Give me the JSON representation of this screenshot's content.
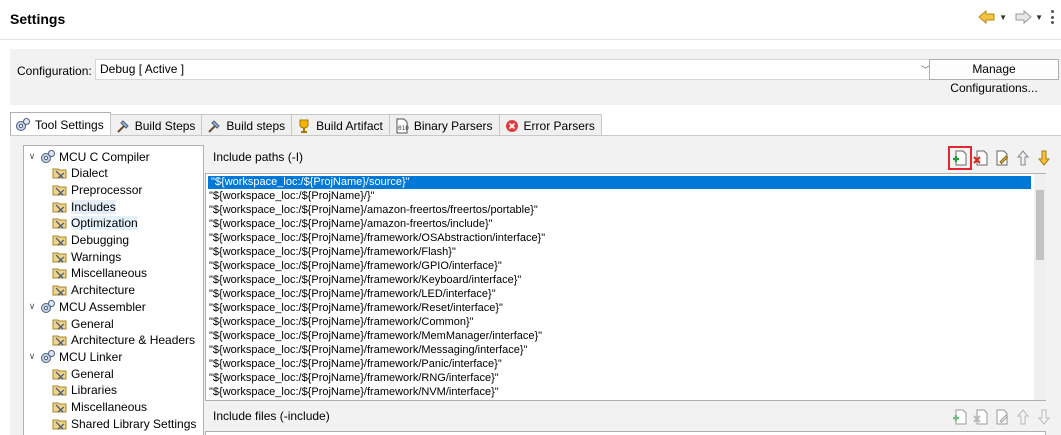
{
  "window": {
    "title": "Settings"
  },
  "configuration": {
    "label": "Configuration:",
    "value": "Debug  [ Active ]",
    "manage_label": "Manage Configurations..."
  },
  "tabs": [
    {
      "label": "Tool Settings",
      "icon": "gears-icon",
      "active": true
    },
    {
      "label": "Build Steps",
      "icon": "hammer-icon",
      "active": false
    },
    {
      "label": "Build steps",
      "icon": "hammer-icon",
      "active": false
    },
    {
      "label": "Build Artifact",
      "icon": "trophy-icon",
      "active": false
    },
    {
      "label": "Binary Parsers",
      "icon": "binary-icon",
      "active": false
    },
    {
      "label": "Error Parsers",
      "icon": "error-icon",
      "active": false
    }
  ],
  "tree": [
    {
      "label": "MCU C Compiler",
      "level": 0,
      "expanded": true
    },
    {
      "label": "Dialect",
      "level": 1
    },
    {
      "label": "Preprocessor",
      "level": 1
    },
    {
      "label": "Includes",
      "level": 1,
      "selected": true
    },
    {
      "label": "Optimization",
      "level": 1,
      "hovered": true
    },
    {
      "label": "Debugging",
      "level": 1
    },
    {
      "label": "Warnings",
      "level": 1
    },
    {
      "label": "Miscellaneous",
      "level": 1
    },
    {
      "label": "Architecture",
      "level": 1
    },
    {
      "label": "MCU Assembler",
      "level": 0,
      "expanded": true
    },
    {
      "label": "General",
      "level": 1
    },
    {
      "label": "Architecture & Headers",
      "level": 1
    },
    {
      "label": "MCU Linker",
      "level": 0,
      "expanded": true
    },
    {
      "label": "General",
      "level": 1
    },
    {
      "label": "Libraries",
      "level": 1
    },
    {
      "label": "Miscellaneous",
      "level": 1
    },
    {
      "label": "Shared Library Settings",
      "level": 1
    }
  ],
  "include_paths": {
    "title": "Include paths (-I)",
    "items": [
      "\"${workspace_loc:/${ProjName}/source}\"",
      "\"${workspace_loc:/${ProjName}/}\"",
      "\"${workspace_loc:/${ProjName}/amazon-freertos/freertos/portable}\"",
      "\"${workspace_loc:/${ProjName}/amazon-freertos/include}\"",
      "\"${workspace_loc:/${ProjName}/framework/OSAbstraction/interface}\"",
      "\"${workspace_loc:/${ProjName}/framework/Flash}\"",
      "\"${workspace_loc:/${ProjName}/framework/GPIO/interface}\"",
      "\"${workspace_loc:/${ProjName}/framework/Keyboard/interface}\"",
      "\"${workspace_loc:/${ProjName}/framework/LED/interface}\"",
      "\"${workspace_loc:/${ProjName}/framework/Reset/interface}\"",
      "\"${workspace_loc:/${ProjName}/framework/Common}\"",
      "\"${workspace_loc:/${ProjName}/framework/MemManager/interface}\"",
      "\"${workspace_loc:/${ProjName}/framework/Messaging/interface}\"",
      "\"${workspace_loc:/${ProjName}/framework/Panic/interface}\"",
      "\"${workspace_loc:/${ProjName}/framework/RNG/interface}\"",
      "\"${workspace_loc:/${ProjName}/framework/NVM/interface}\""
    ],
    "selected_index": 0
  },
  "include_files": {
    "title": "Include files (-include)"
  },
  "colors": {
    "selection": "#0078d7",
    "highlight_outline": "#e0282e"
  }
}
